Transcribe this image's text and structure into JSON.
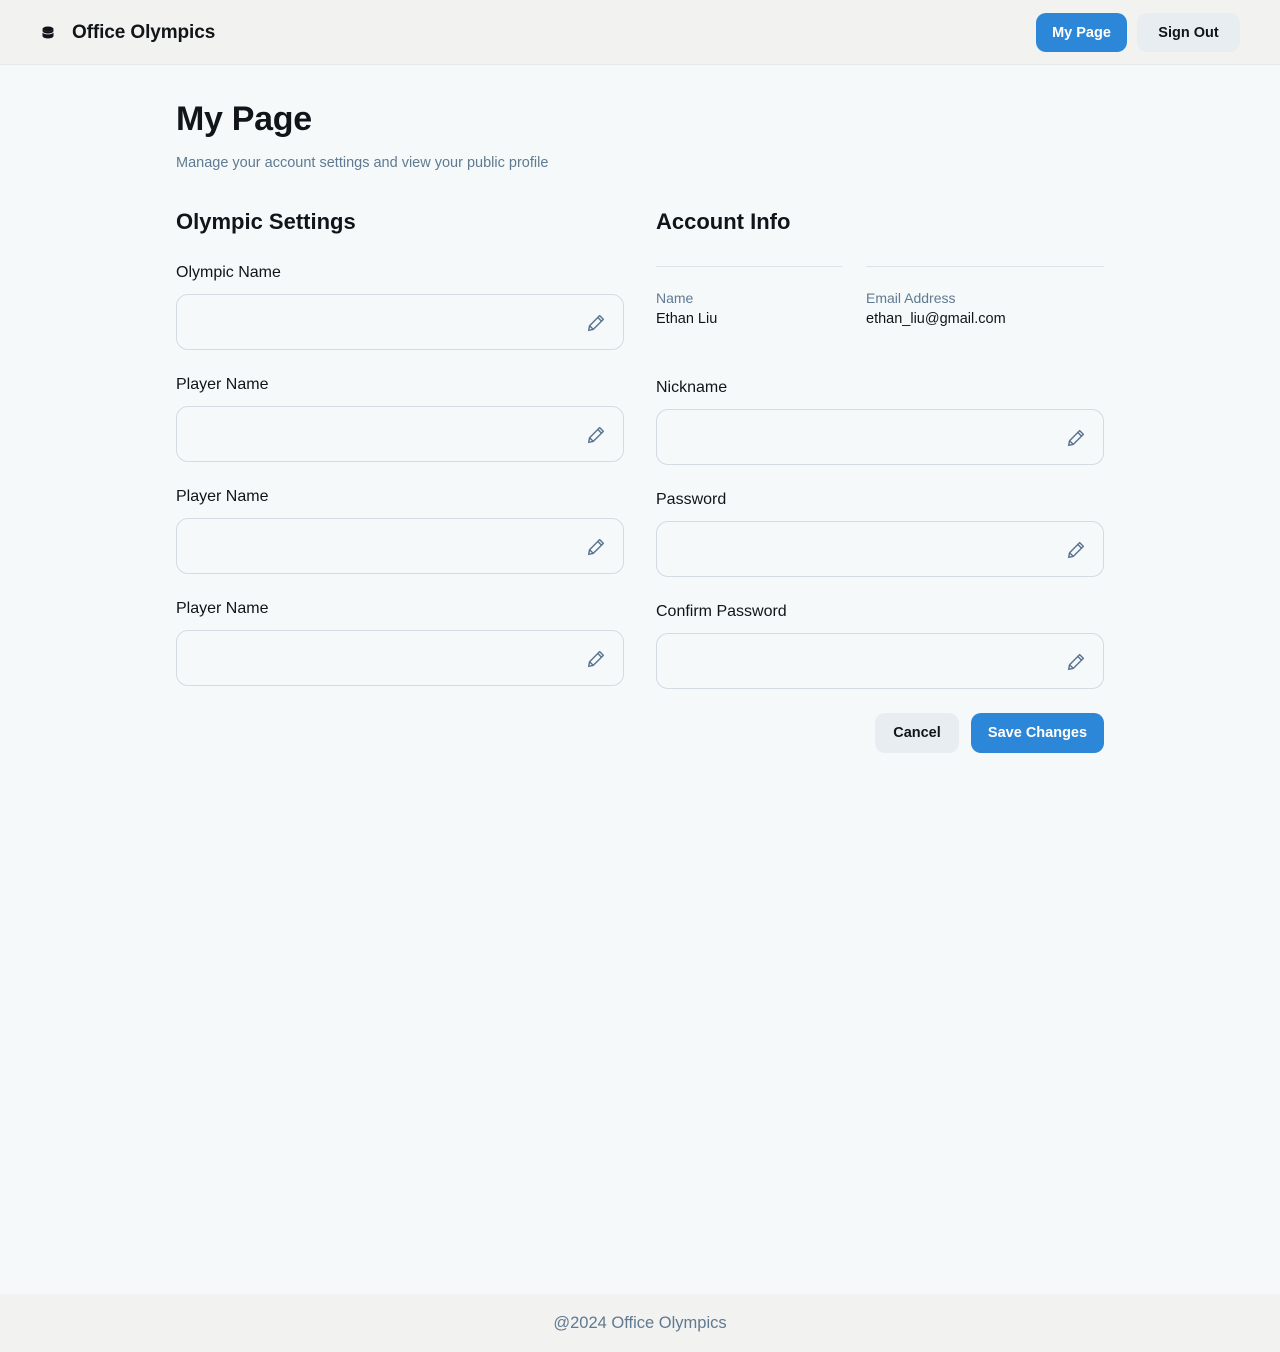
{
  "header": {
    "brand_icon": "database-icon",
    "brand_title": "Office Olympics",
    "my_page_label": "My Page",
    "sign_out_label": "Sign Out"
  },
  "page": {
    "title": "My Page",
    "subtitle": "Manage your account settings and view your public profile"
  },
  "olympic_settings": {
    "title": "Olympic Settings",
    "fields": [
      {
        "label": "Olympic Name",
        "value": "",
        "icon": "pencil-icon"
      },
      {
        "label": "Player Name",
        "value": "",
        "icon": "pencil-icon"
      },
      {
        "label": "Player Name",
        "value": "",
        "icon": "pencil-icon"
      },
      {
        "label": "Player Name",
        "value": "",
        "icon": "pencil-icon"
      }
    ]
  },
  "account_info": {
    "title": "Account Info",
    "name_label": "Name",
    "name_value": "Ethan Liu",
    "email_label": "Email Address",
    "email_value": "ethan_liu@gmail.com",
    "fields": [
      {
        "label": "Nickname",
        "value": "",
        "icon": "pencil-icon"
      },
      {
        "label": "Password",
        "value": "",
        "icon": "pencil-icon"
      },
      {
        "label": "Confirm Password",
        "value": "",
        "icon": "pencil-icon"
      }
    ],
    "cancel_label": "Cancel",
    "save_label": "Save Changes"
  },
  "footer": {
    "text": "@2024 Office Olympics"
  },
  "colors": {
    "accent": "#2d87d9",
    "background": "#f5f9fa",
    "header_bg": "#f2f2f0",
    "muted_text": "#5f7a91"
  }
}
